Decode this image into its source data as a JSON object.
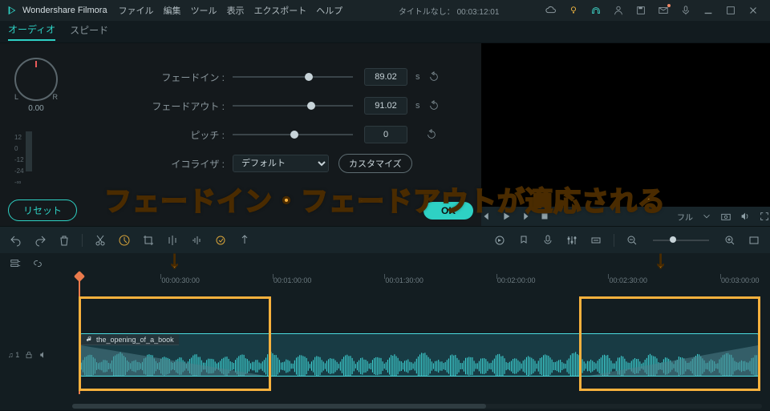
{
  "app": {
    "name": "Wondershare Filmora"
  },
  "menu": {
    "items": [
      "ファイル",
      "編集",
      "ツール",
      "表示",
      "エクスポート",
      "ヘルプ"
    ],
    "project_title": "タイトルなし： 00:03:12:01"
  },
  "tabs": {
    "audio": "オーディオ",
    "speed": "スピード"
  },
  "pan": {
    "left": "L",
    "right": "R",
    "value": "0.00"
  },
  "sliders": {
    "fadein": {
      "label": "フェードイン :",
      "value": "89.02",
      "unit": "s"
    },
    "fadeout": {
      "label": "フェードアウト :",
      "value": "91.02",
      "unit": "s"
    },
    "pitch": {
      "label": "ピッチ :",
      "value": "0"
    },
    "eq": {
      "label": "イコライザ :",
      "selected": "デフォルト",
      "customize": "カスタマイズ"
    }
  },
  "panel_buttons": {
    "reset": "リセット",
    "ok": "OK"
  },
  "preview": {
    "full": "フル"
  },
  "ruler": {
    "ticks": [
      {
        "pos": 13,
        "label": "00:00:30:00"
      },
      {
        "pos": 29,
        "label": "00:01:00:00"
      },
      {
        "pos": 45,
        "label": "00:01:30:00"
      },
      {
        "pos": 61,
        "label": "00:02:00:00"
      },
      {
        "pos": 77,
        "label": "00:02:30:00"
      },
      {
        "pos": 93,
        "label": "00:03:00:00"
      }
    ]
  },
  "track": {
    "name": "♫ 1",
    "clip_label": "the_opening_of_a_book"
  },
  "annotation": {
    "text": "フェードイン・フェードアウトが適応される",
    "arrow": "↓"
  }
}
